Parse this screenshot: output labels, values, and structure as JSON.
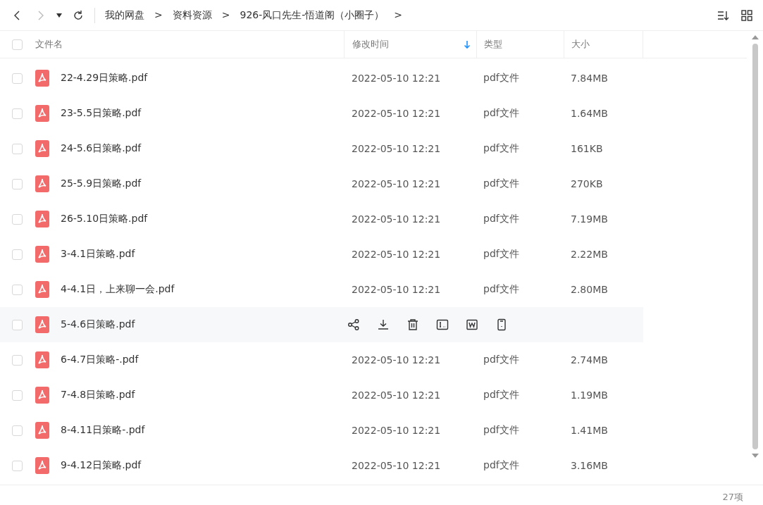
{
  "breadcrumb": [
    "我的网盘",
    ">",
    "资料资源",
    ">",
    "926-风口先生-悟道阁（小圈子）",
    ">"
  ],
  "select_all": {
    "checked": false
  },
  "columns": [
    {
      "label": "文件名",
      "sorted": false
    },
    {
      "label": "修改时间",
      "sorted": true
    },
    {
      "label": "类型",
      "sorted": false
    },
    {
      "label": "大小",
      "sorted": false
    }
  ],
  "rows": [
    {
      "name": "22-4.29日策略.pdf",
      "modified": "2022-05-10 12:21",
      "type": "pdf文件",
      "size": "7.84MB",
      "hovered": false,
      "checked": false
    },
    {
      "name": "23-5.5日策略.pdf",
      "modified": "2022-05-10 12:21",
      "type": "pdf文件",
      "size": "1.64MB",
      "hovered": false,
      "checked": false
    },
    {
      "name": "24-5.6日策略.pdf",
      "modified": "2022-05-10 12:21",
      "type": "pdf文件",
      "size": "161KB",
      "hovered": false,
      "checked": false
    },
    {
      "name": "25-5.9日策略.pdf",
      "modified": "2022-05-10 12:21",
      "type": "pdf文件",
      "size": "270KB",
      "hovered": false,
      "checked": false
    },
    {
      "name": "26-5.10日策略.pdf",
      "modified": "2022-05-10 12:21",
      "type": "pdf文件",
      "size": "7.19MB",
      "hovered": false,
      "checked": false
    },
    {
      "name": "3-4.1日策略.pdf",
      "modified": "2022-05-10 12:21",
      "type": "pdf文件",
      "size": "2.22MB",
      "hovered": false,
      "checked": false
    },
    {
      "name": "4-4.1日，上来聊一会.pdf",
      "modified": "2022-05-10 12:21",
      "type": "pdf文件",
      "size": "2.80MB",
      "hovered": false,
      "checked": false
    },
    {
      "name": "5-4.6日策略.pdf",
      "hovered": true,
      "checked": false
    },
    {
      "name": "6-4.7日策略-.pdf",
      "modified": "2022-05-10 12:21",
      "type": "pdf文件",
      "size": "2.74MB",
      "hovered": false,
      "checked": false
    },
    {
      "name": "7-4.8日策略.pdf",
      "modified": "2022-05-10 12:21",
      "type": "pdf文件",
      "size": "1.19MB",
      "hovered": false,
      "checked": false
    },
    {
      "name": "8-4.11日策略-.pdf",
      "modified": "2022-05-10 12:21",
      "type": "pdf文件",
      "size": "1.41MB",
      "hovered": false,
      "checked": false
    },
    {
      "name": "9-4.12日策略.pdf",
      "modified": "2022-05-10 12:21",
      "type": "pdf文件",
      "size": "3.16MB",
      "hovered": false,
      "checked": false
    }
  ],
  "status_bar": {
    "count": "27项"
  }
}
